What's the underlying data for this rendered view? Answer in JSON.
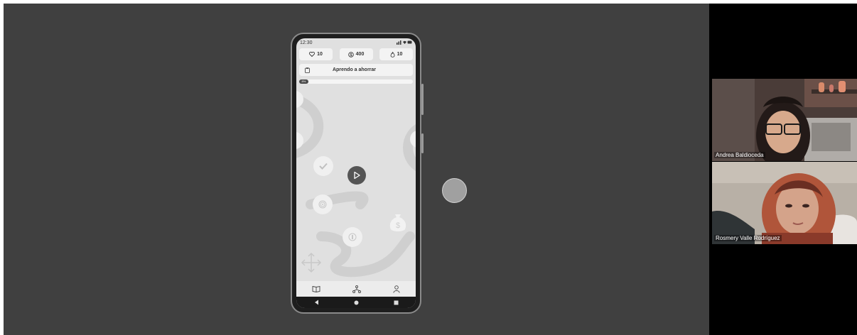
{
  "phone": {
    "status": {
      "time": "12:30"
    },
    "stats": [
      {
        "icon": "heart-icon",
        "value": "10"
      },
      {
        "icon": "coin-icon",
        "value": "400"
      },
      {
        "icon": "flame-icon",
        "value": "10"
      }
    ],
    "lesson": {
      "title": "Aprendo a ahorrar"
    },
    "progress": {
      "label": "8%",
      "value": 0.08
    },
    "bottom_nav": [
      "book-icon",
      "roadmap-icon",
      "profile-icon"
    ],
    "android_nav": [
      "back-icon",
      "home-icon",
      "recents-icon"
    ]
  },
  "participants": [
    {
      "name": "Andrea Baldioceda"
    },
    {
      "name": "Rosmery Valle Rodríguez"
    }
  ],
  "colors": {
    "stage": "#404040",
    "side_panel": "#000000",
    "screen_bg": "#e0e0e0",
    "active_node": "#555555"
  }
}
